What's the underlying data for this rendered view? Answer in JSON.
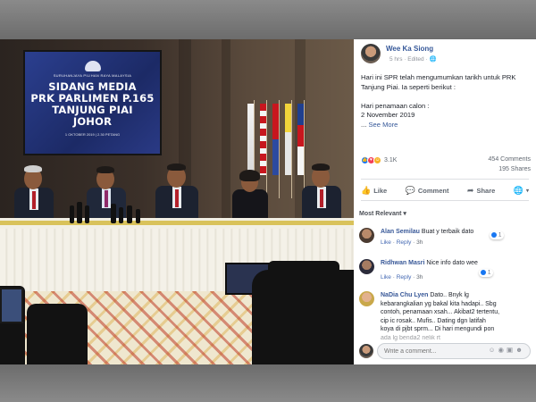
{
  "backdrop": {
    "org": "SURUHANJAYA PILIHAN RAYA MALAYSIA",
    "line1": "SIDANG MEDIA",
    "line2": "PRK PARLIMEN P.165",
    "line3": "TANJUNG PIAI",
    "line4": "JOHOR",
    "date": "1 OKTOBER 2019 | 2.30 PETANG"
  },
  "post": {
    "author": "Wee Ka Siong",
    "time": "5 hrs",
    "edited": "Edited",
    "privacy_icon": "globe-icon",
    "paragraph1": "Hari ini SPR telah mengumumkan tarikh untuk PRK Tanjung Piai. Ia seperti berikut :",
    "label_nomination": "Hari penamaan calon :",
    "date_nomination": "2 November 2019",
    "ellipsis": "...",
    "see_more": "See More",
    "reaction_count": "3.1K",
    "comments_count": "454 Comments",
    "shares_count": "195 Shares",
    "actions": {
      "like": "Like",
      "comment": "Comment",
      "share": "Share"
    },
    "sort_label": "Most Relevant"
  },
  "comments": [
    {
      "name": "Alan Semilau",
      "text": "Buat y terbaik dato",
      "like": "Like",
      "reply": "Reply",
      "time": "3h",
      "reactions": "1"
    },
    {
      "name": "Ridhwan Masri",
      "text": "Nice info dato wee",
      "like": "Like",
      "reply": "Reply",
      "time": "3h",
      "reactions": "1"
    },
    {
      "name": "NaDia Chu Lyen",
      "line1": "Dato.. Bnyk lg",
      "line2": "kebarangkalian yg bakal kita hadapi.. Sbg",
      "line3": "contoh, penamaan xsah... Akibat2 tertentu,",
      "line4": "cip ic rosak.. Mufis.. Dating dgn latifah",
      "line5": "koya di pjbt sprm... Di hari mengundi pon",
      "line6": "ada lg benda2 nelik rt"
    }
  ],
  "composer": {
    "placeholder": "Write a comment..."
  },
  "colors": {
    "link": "#365899",
    "accent": "#4267b2",
    "backdrop": "#1c2a66"
  }
}
